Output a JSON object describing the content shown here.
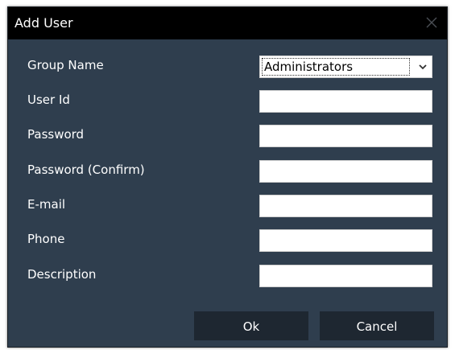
{
  "dialog": {
    "title": "Add User",
    "close_icon": "close-icon"
  },
  "form": {
    "group_name_label": "Group Name",
    "group_name_value": "Administrators",
    "user_id_label": "User Id",
    "user_id_value": "",
    "password_label": "Password",
    "password_value": "",
    "password_confirm_label": "Password (Confirm)",
    "password_confirm_value": "",
    "email_label": "E-mail",
    "email_value": "",
    "phone_label": "Phone",
    "phone_value": "",
    "description_label": "Description",
    "description_value": ""
  },
  "buttons": {
    "ok_label": "Ok",
    "cancel_label": "Cancel"
  },
  "colors": {
    "dialog_bg": "#2f3e4e",
    "titlebar_bg": "#000000",
    "button_bg": "#1e2731",
    "text": "#ffffff"
  }
}
